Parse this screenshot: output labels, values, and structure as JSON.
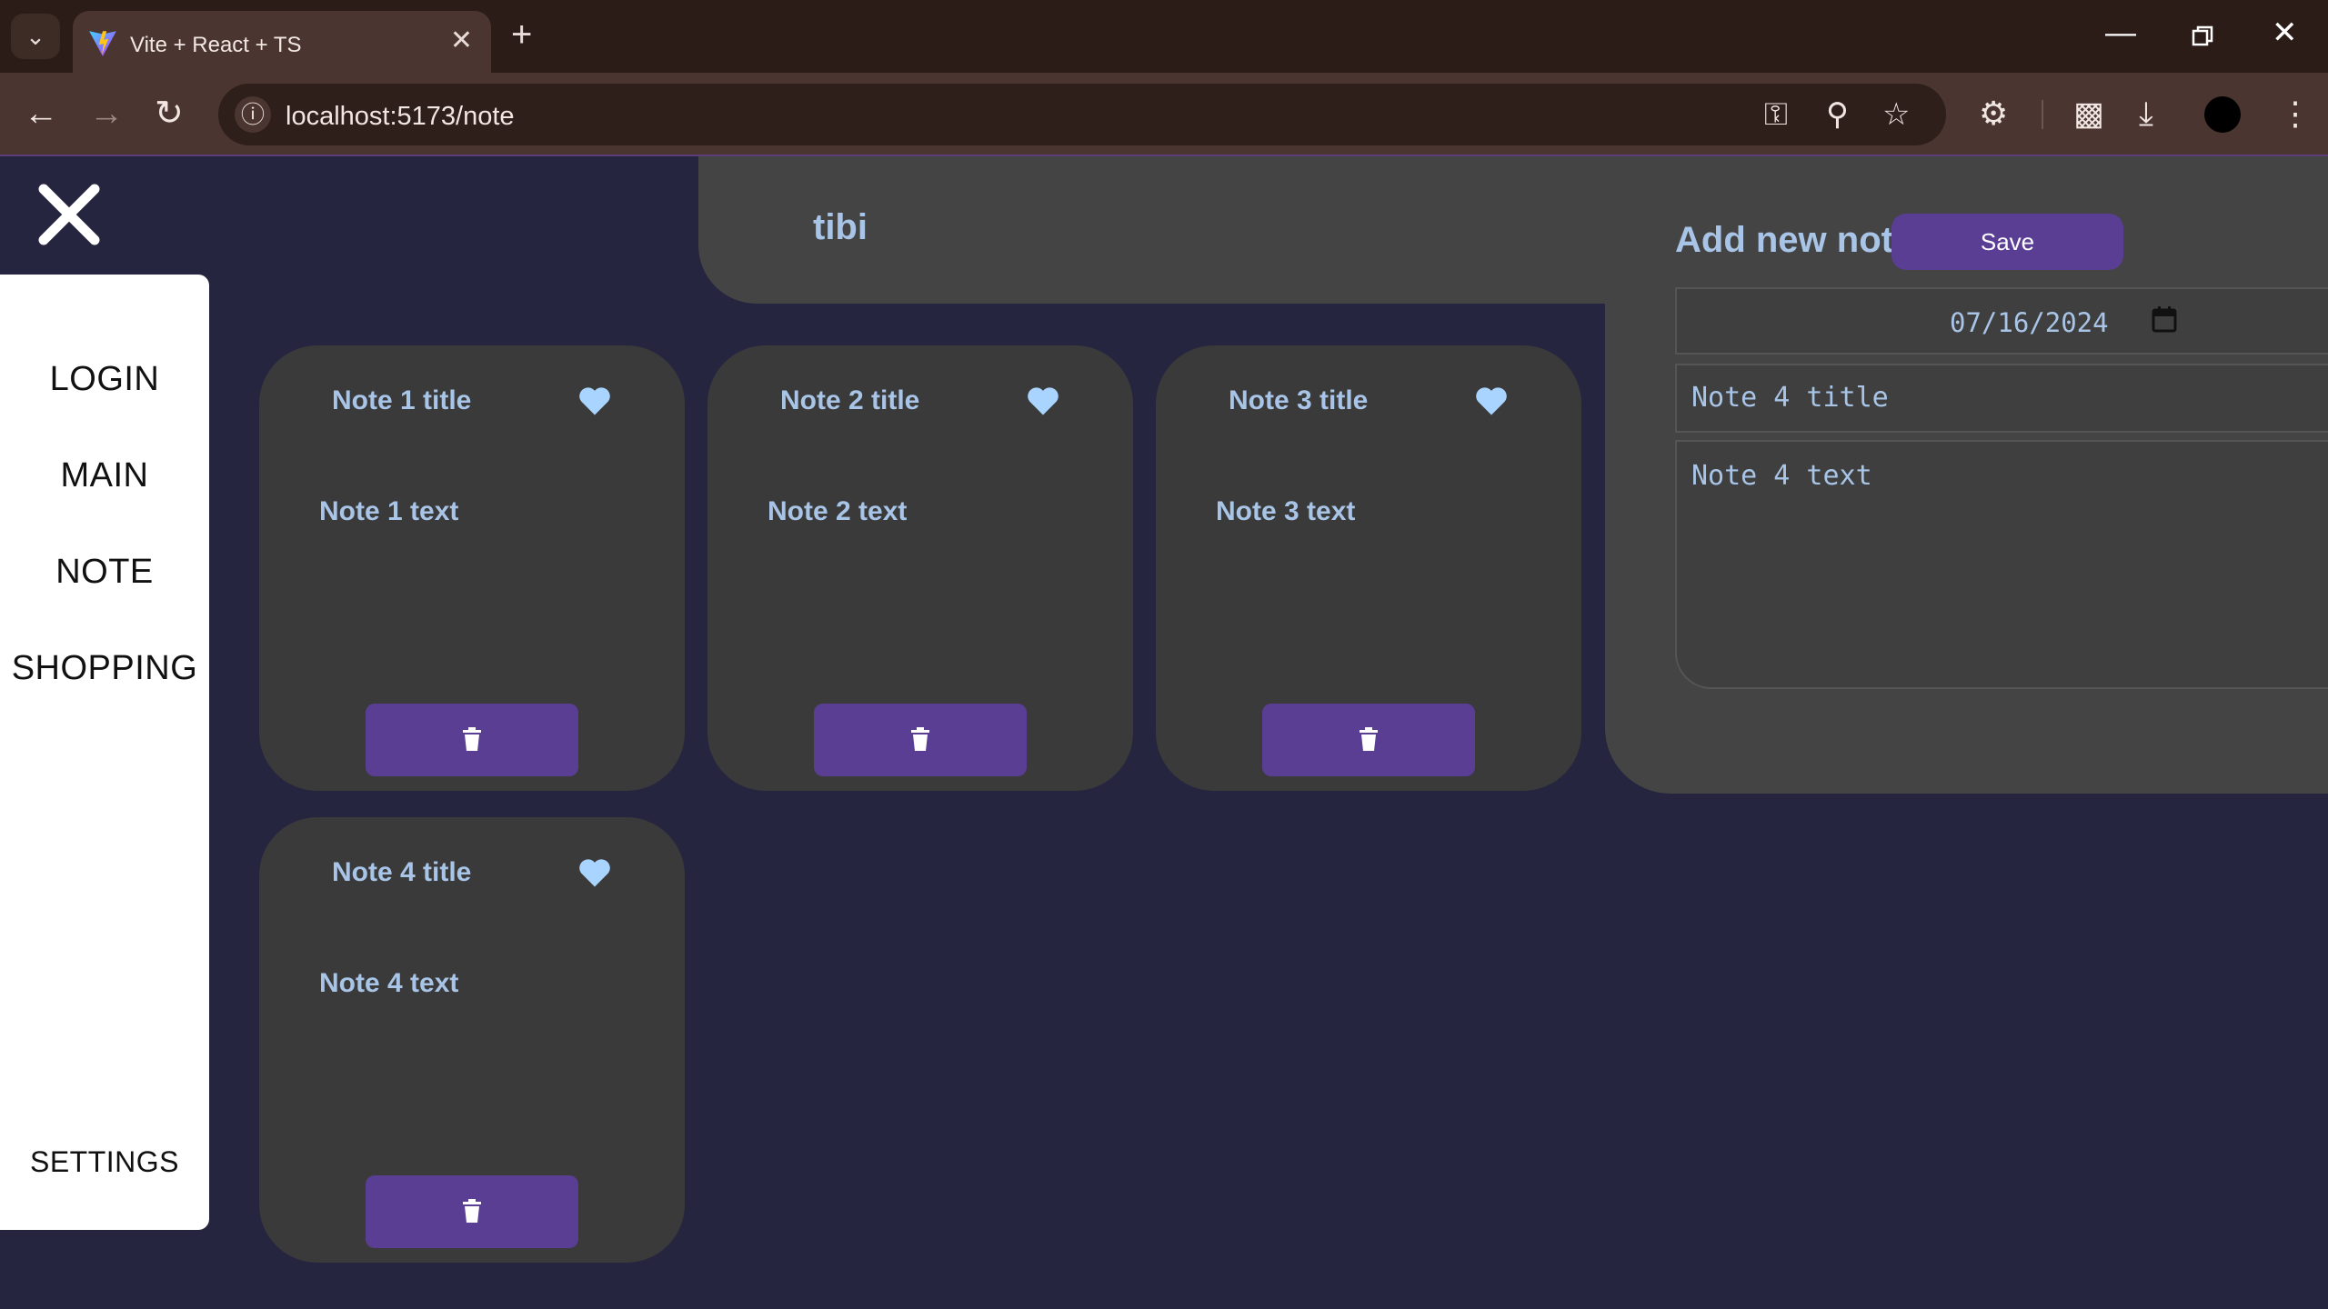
{
  "browser": {
    "tab_title": "Vite + React + TS",
    "url": "localhost:5173/note",
    "icons": [
      "tab-menu-icon",
      "vite-favicon",
      "tab-close-icon",
      "new-tab-icon",
      "minimize-icon",
      "restore-icon",
      "window-close-icon",
      "back-icon",
      "forward-icon",
      "reload-icon",
      "site-info-icon",
      "password-key-icon",
      "zoom-icon",
      "bookmark-star-icon",
      "extensions-icon",
      "cast-icon",
      "download-icon",
      "profile-avatar",
      "more-menu-icon"
    ]
  },
  "sidebar": {
    "items": [
      {
        "label": "LOGIN"
      },
      {
        "label": "MAIN"
      },
      {
        "label": "NOTE"
      },
      {
        "label": "SHOPPING"
      }
    ],
    "settings_label": "SETTINGS"
  },
  "header": {
    "user_name": "tibi"
  },
  "add_note": {
    "title": "Add new note",
    "save_label": "Save",
    "date_value": "07/16/2024",
    "title_value": "Note 4 title",
    "text_value": "Note 4 text"
  },
  "notes": [
    {
      "title": "Note 1 title",
      "text": "Note 1 text"
    },
    {
      "title": "Note 2 title",
      "text": "Note 2 text"
    },
    {
      "title": "Note 3 title",
      "text": "Note 3 text"
    },
    {
      "title": "Note 4 title",
      "text": "Note 4 text"
    }
  ],
  "colors": {
    "page_bg": "#252540",
    "panel_bg": "#444444",
    "card_bg": "#3a3a3a",
    "accent": "#5a3e94",
    "text_accent": "#a8c4e6"
  }
}
